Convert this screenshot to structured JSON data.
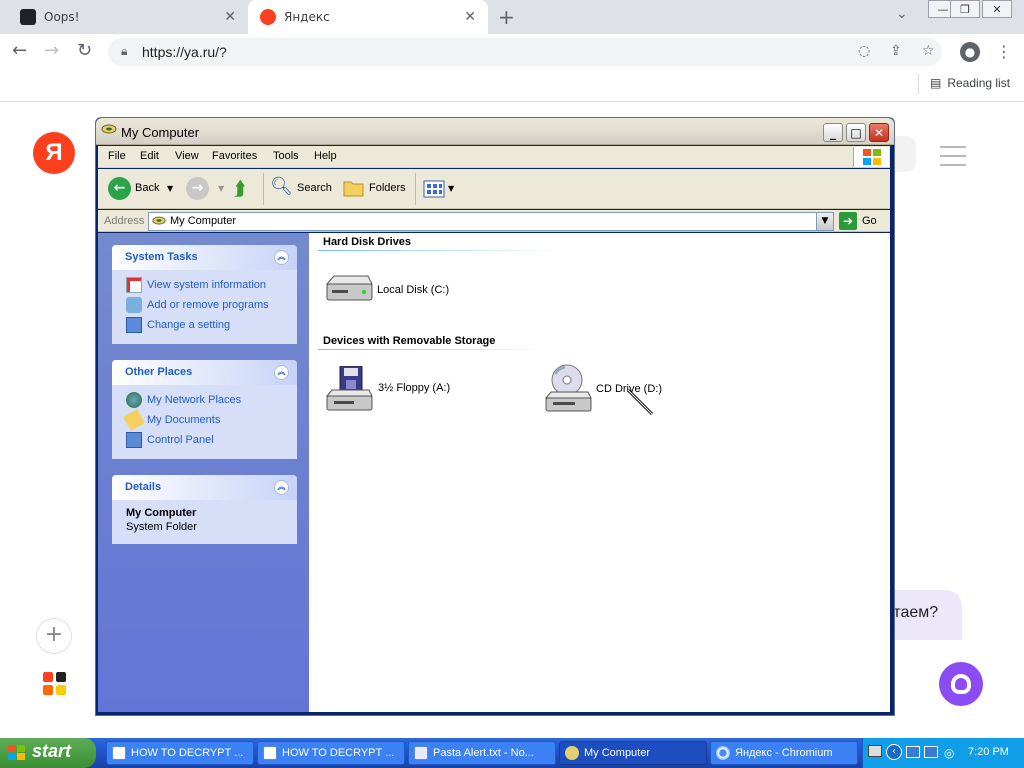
{
  "browser": {
    "tabs": [
      {
        "title": "Oops!",
        "active": false
      },
      {
        "title": "Яндекс",
        "active": true
      }
    ],
    "url": "https://ya.ru/?",
    "reading_list": "Reading list",
    "page": {
      "logo_letter": "Я",
      "chat_text": "лтаем?"
    }
  },
  "window": {
    "title": "My Computer",
    "menu": [
      "File",
      "Edit",
      "View",
      "Favorites",
      "Tools",
      "Help"
    ],
    "toolbar": {
      "back": "Back",
      "search": "Search",
      "folders": "Folders"
    },
    "address": {
      "label": "Address",
      "value": "My Computer",
      "go": "Go"
    },
    "system_tasks": {
      "title": "System Tasks",
      "items": [
        "View system information",
        "Add or remove programs",
        "Change a setting"
      ]
    },
    "other_places": {
      "title": "Other Places",
      "items": [
        "My Network Places",
        "My Documents",
        "Control Panel"
      ]
    },
    "details": {
      "title": "Details",
      "name": "My Computer",
      "type": "System Folder"
    },
    "sections": [
      {
        "title": "Hard Disk Drives",
        "items": [
          "Local Disk (C:)"
        ]
      },
      {
        "title": "Devices with Removable Storage",
        "items": [
          "3½ Floppy (A:)",
          "CD Drive (D:)"
        ]
      }
    ]
  },
  "taskbar": {
    "start": "start",
    "tasks": [
      {
        "label": "HOW TO DECRYPT ...",
        "active": false
      },
      {
        "label": "HOW TO DECRYPT ...",
        "active": false
      },
      {
        "label": "Pasta Alert.txt - No...",
        "active": false
      },
      {
        "label": "My Computer",
        "active": true
      },
      {
        "label": "Яндекс - Chromium",
        "active": false
      }
    ],
    "clock": "7:20 PM"
  },
  "colors": {
    "xp_blue": "#215dc6",
    "yandex_red": "#fc3f1d",
    "alice_purple": "#8b4cf5",
    "taskbar_blue": "#245edb",
    "start_green": "#3c8f35"
  }
}
